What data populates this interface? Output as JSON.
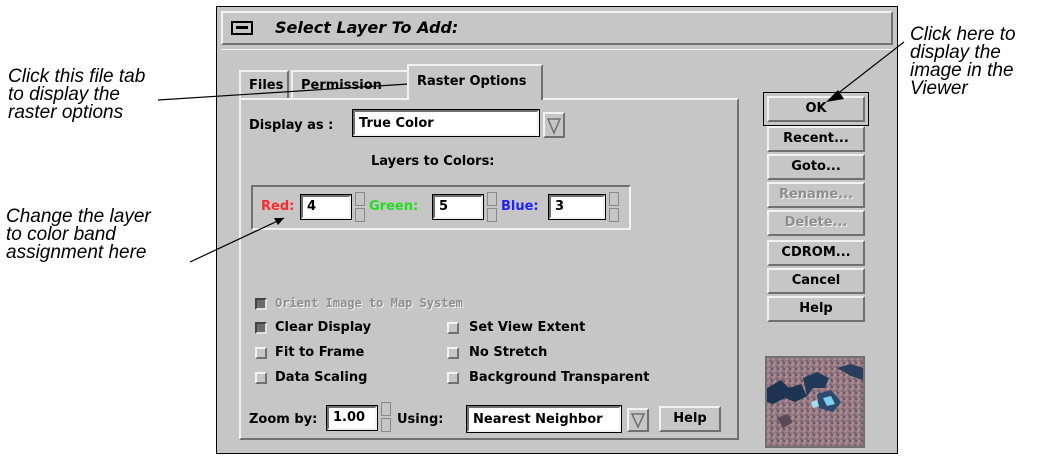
{
  "callouts": {
    "tab_note": [
      "Click this file tab",
      "to display the",
      "raster options"
    ],
    "layer_note": [
      "Change the layer",
      "to color band",
      "assignment here"
    ],
    "ok_note": [
      "Click here to",
      "display the",
      "image in the",
      "Viewer"
    ]
  },
  "dialog": {
    "title": "Select Layer To Add:",
    "tabs": [
      {
        "label": "Files",
        "active": false
      },
      {
        "label": "Permission",
        "active": false
      },
      {
        "label": "Raster Options",
        "active": true
      }
    ],
    "display_as_label": "Display as :",
    "display_as_value": "True Color",
    "layers_heading": "Layers to Colors:",
    "bands": [
      {
        "label": "Red:",
        "value": "4",
        "color": "#ff2a2a"
      },
      {
        "label": "Green:",
        "value": "5",
        "color": "#22dd22"
      },
      {
        "label": "Blue:",
        "value": "3",
        "color": "#2222ff"
      }
    ],
    "options": {
      "orient": {
        "label": "Orient Image to Map System",
        "checked": true,
        "enabled": false
      },
      "clear_display": {
        "label": "Clear Display",
        "checked": true
      },
      "set_view_extent": {
        "label": "Set View Extent",
        "checked": false
      },
      "fit_to_frame": {
        "label": "Fit to Frame",
        "checked": false
      },
      "no_stretch": {
        "label": "No Stretch",
        "checked": false
      },
      "data_scaling": {
        "label": "Data Scaling",
        "checked": false
      },
      "background_transparent": {
        "label": "Background Transparent",
        "checked": false
      }
    },
    "zoom_label": "Zoom by:",
    "zoom_value": "1.00",
    "using_label": "Using:",
    "using_value": "Nearest Neighbor",
    "help_inline": "Help",
    "side_buttons": [
      {
        "label": "OK",
        "enabled": true
      },
      {
        "label": "Recent...",
        "enabled": true
      },
      {
        "label": "Goto...",
        "enabled": true
      },
      {
        "label": "Rename...",
        "enabled": false
      },
      {
        "label": "Delete...",
        "enabled": false
      },
      {
        "label": "CDROM...",
        "enabled": true
      },
      {
        "label": "Cancel",
        "enabled": true
      },
      {
        "label": "Help",
        "enabled": true
      }
    ]
  }
}
